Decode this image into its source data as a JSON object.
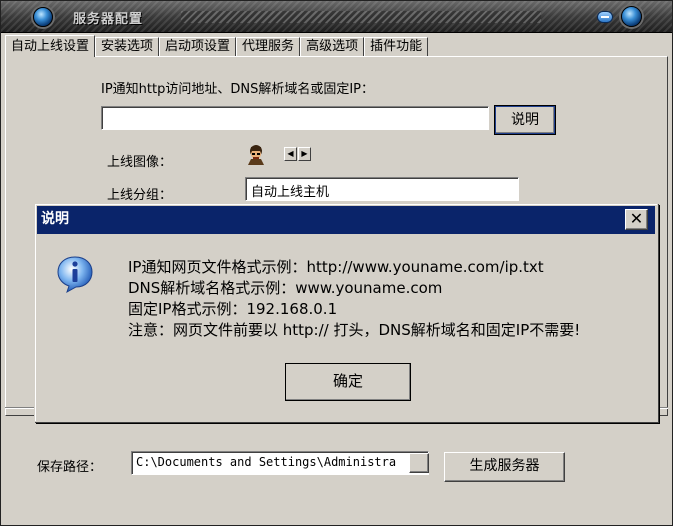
{
  "window": {
    "title": "服务器配置"
  },
  "tabs": [
    {
      "label": "自动上线设置"
    },
    {
      "label": "安装选项"
    },
    {
      "label": "启动项设置"
    },
    {
      "label": "代理服务"
    },
    {
      "label": "高级选项"
    },
    {
      "label": "插件功能"
    }
  ],
  "auto_online": {
    "ip_prompt": "IP通知http访问地址、DNS解析域名或固定IP：",
    "url_value": "",
    "explain_button": "说明",
    "avatar_label": "上线图像：",
    "group_label": "上线分组：",
    "group_value": "自动上线主机"
  },
  "bottom": {
    "save_path_label": "保存路径：",
    "save_path_value": "C:\\Documents and Settings\\Administra",
    "generate_button": "生成服务器"
  },
  "dialog": {
    "title": "说明",
    "close_label": "✕",
    "lines": [
      "IP通知网页文件格式示例：http://www.youname.com/ip.txt",
      "DNS解析域名格式示例：www.youname.com",
      "固定IP格式示例：192.168.0.1",
      "注意：网页文件前要以 http:// 打头，DNS解析域名和固定IP不需要!"
    ],
    "ok_button": "确定"
  },
  "colors": {
    "dialog_title_bg": "#0a246a",
    "face": "#d4d0c8"
  }
}
